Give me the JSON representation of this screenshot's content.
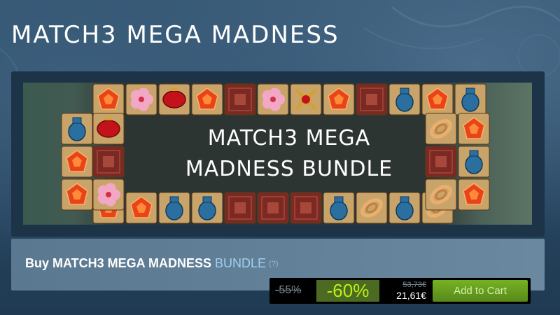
{
  "page": {
    "title": "MATCH3 MEGA MADNESS"
  },
  "banner": {
    "line1": "MATCH3 MEGA",
    "line2": "MADNESS BUNDLE",
    "tiles_top": [
      "gem",
      "flower",
      "lantern",
      "gem",
      "carpet",
      "flower",
      "knot",
      "gem",
      "carpet",
      "vase",
      "gem",
      "vase"
    ],
    "tiles_left": [
      "vase",
      "gem",
      "gem"
    ],
    "tiles_left2": [
      "lantern",
      "carpet",
      "flower"
    ],
    "tiles_right": [
      "rope",
      "carpet",
      "rope"
    ],
    "tiles_right2": [
      "gem",
      "vase",
      "gem"
    ],
    "tiles_bottom": [
      "gem",
      "gem",
      "vase",
      "vase",
      "carpet",
      "carpet",
      "carpet",
      "vase",
      "rope",
      "vase",
      "rope"
    ]
  },
  "purchase": {
    "buy_prefix": "Buy MATCH3 MEGA MADNESS",
    "bundle_label": "BUNDLE",
    "help": "(?)",
    "bundle_discount": "-55%",
    "discount": "-60%",
    "original_price": "53,73€",
    "final_price": "21,61€",
    "add_to_cart": "Add to Cart"
  },
  "colors": {
    "discount_bg": "#4c6b22",
    "discount_text": "#beee11",
    "cart_button": "#75b022",
    "bundle_accent": "#9fd0f0"
  }
}
